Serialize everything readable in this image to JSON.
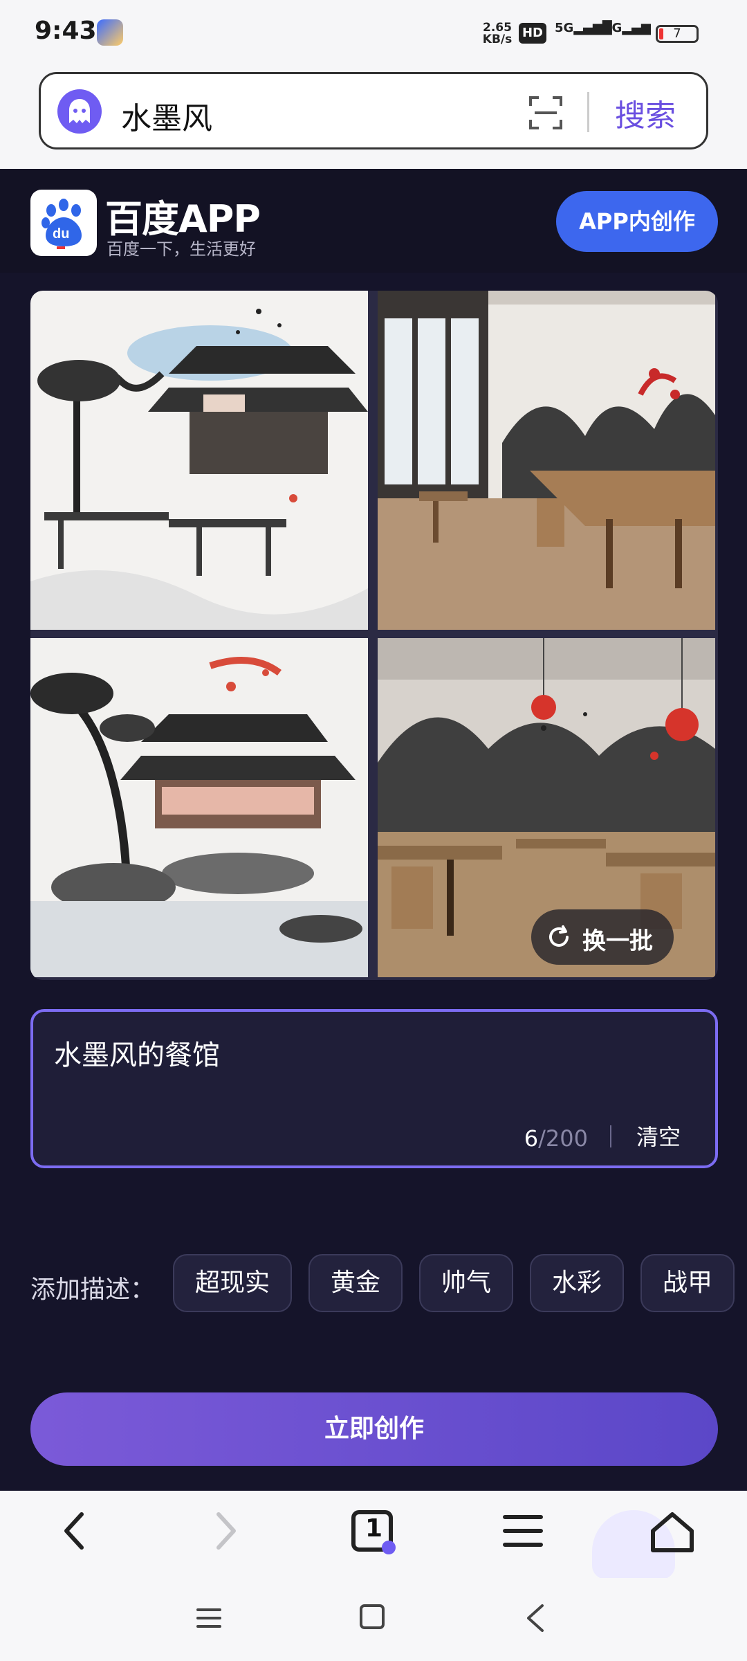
{
  "status": {
    "time": "9:43",
    "net_speed_value": "2.65",
    "net_speed_unit": "KB/s",
    "hd": "HD",
    "sig1": "5G",
    "sig2": "5G",
    "battery": "7"
  },
  "search": {
    "query": "水墨风",
    "button": "搜索"
  },
  "header": {
    "brand": "百度APP",
    "slogan": "百度一下，生活更好",
    "cta": "APP内创作"
  },
  "gallery": {
    "refresh_label": "换一批"
  },
  "prompt": {
    "text": "水墨风的餐馆",
    "count": "6",
    "limit": "/200",
    "clear": "清空"
  },
  "tags": {
    "label": "添加描述：",
    "items": [
      "超现实",
      "黄金",
      "帅气",
      "水彩",
      "战甲"
    ]
  },
  "create": {
    "label": "立即创作"
  },
  "bottom_nav": {
    "tabs_count": "1"
  },
  "colors": {
    "accent": "#6f5cf2",
    "cta_blue": "#3d67ee",
    "dark_bg": "#15142a"
  }
}
